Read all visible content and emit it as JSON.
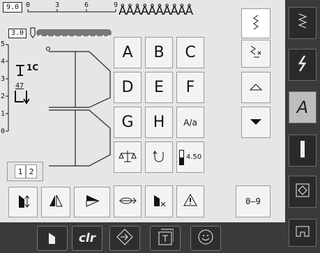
{
  "top": {
    "stitch_width": "9.0",
    "stitch_length": "3.0",
    "width_scale": [
      "0",
      "3",
      "6",
      "9"
    ],
    "length_scale": [
      "5",
      "4",
      "3",
      "2",
      "1",
      "0"
    ],
    "needle_label": "1C",
    "presser_label": "47",
    "zigzag_title": "ÅÅÅÅÅÅÅÅÅÅ"
  },
  "letters": [
    "A",
    "B",
    "C",
    "D",
    "E",
    "F",
    "G",
    "H"
  ],
  "font_toggle": "A/a",
  "tension_value": "4.50",
  "numbers_label": "0–9",
  "clr_label": "clr",
  "view_buttons": [
    "1",
    "2"
  ],
  "icons": {
    "right_bar": [
      "zigzag-stitch-icon",
      "decorative-stitch-icon",
      "alphabet-icon",
      "buttonhole-icon",
      "quilt-stitch-icon",
      "setup-icon"
    ],
    "bottom_bar": [
      "needle-stop-icon",
      "clear-icon",
      "memory-arrow-icon",
      "memory-file-icon",
      "personal-program-icon"
    ]
  },
  "colors": {
    "panel": "#e6e6e6",
    "dark": "#3a3a3a"
  }
}
